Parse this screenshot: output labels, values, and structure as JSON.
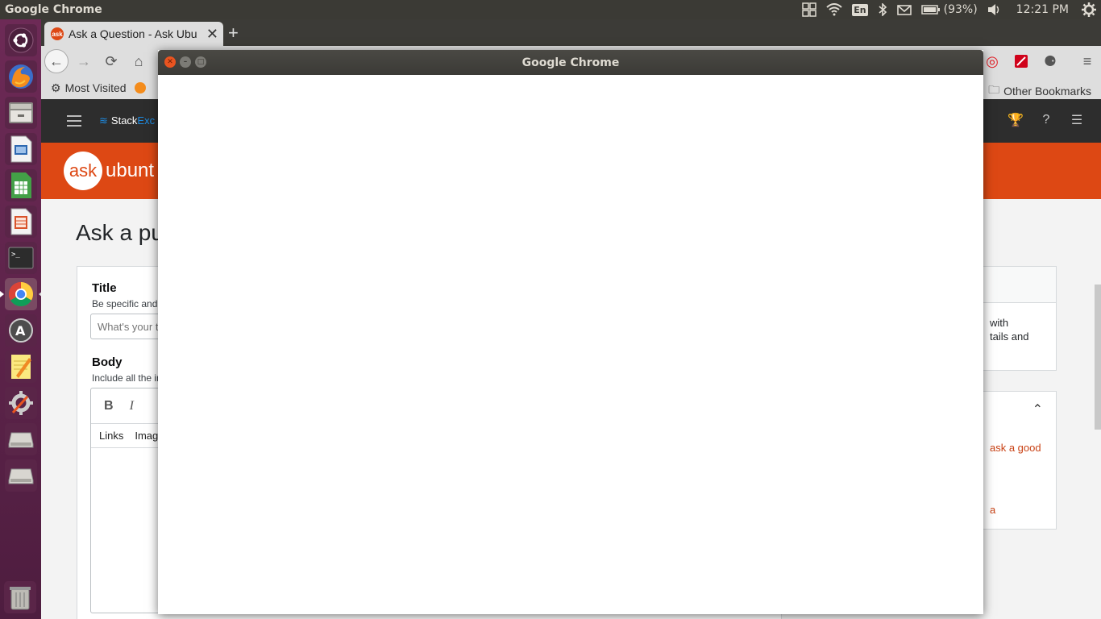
{
  "top_panel": {
    "app_name": "Google Chrome",
    "keyboard_lang": "En",
    "battery": "(93%)",
    "clock": "12:21 PM"
  },
  "launcher": {
    "items": [
      "ubuntu-dash",
      "firefox",
      "files",
      "libreoffice-impress",
      "libreoffice-calc",
      "libreoffice-writer-template",
      "terminal",
      "chrome",
      "software-updater",
      "text-editor",
      "system-settings",
      "disk-1",
      "disk-2"
    ],
    "trash": "trash"
  },
  "browser": {
    "tab_title": "Ask a Question - Ask Ubu",
    "tab_fav": "ask",
    "bookmarks": {
      "most_visited": "Most Visited",
      "other": "Other Bookmarks"
    }
  },
  "page": {
    "se_logo_a": "Stack",
    "se_logo_b": "Exc",
    "au_bubble": "ask",
    "au_word": "ubunt",
    "title": "Ask a pu",
    "form": {
      "title_label": "Title",
      "title_hint": "Be specific and",
      "title_placeholder": "What's your t",
      "body_label": "Body",
      "body_hint": "Include all the in",
      "bold": "B",
      "italic": "I",
      "tab_links": "Links",
      "tab_images": "Imag"
    },
    "side": {
      "card1_line1": "with",
      "card1_line2": "tails and",
      "card2_link1": "ask a good",
      "card2_link2": "a"
    }
  },
  "dialog": {
    "title": "Google Chrome"
  },
  "colors": {
    "ubuntu_orange": "#dd4814",
    "panel_bg": "#3b3a35",
    "launcher_bg": "#6d2a56"
  }
}
